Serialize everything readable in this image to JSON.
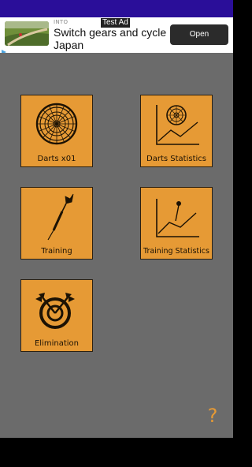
{
  "ad": {
    "brand": "INTO",
    "test_label": "Test Ad",
    "headline": "Switch gears and cycle Japan",
    "cta": "Open"
  },
  "menu": {
    "darts_x01": "Darts x01",
    "darts_statistics": "Darts Statistics",
    "training": "Training",
    "training_statistics": "Training Statistics",
    "elimination": "Elimination"
  },
  "help": {
    "label": "?"
  },
  "colors": {
    "status_bar": "#2a0e99",
    "background": "#6b6b6b",
    "tile": "#e69a35",
    "tile_border": "#2c2010",
    "help_accent": "#e69a35"
  },
  "icons": {
    "darts_x01": "dartboard-icon",
    "darts_statistics": "dartboard-chart-icon",
    "training": "dart-icon",
    "training_statistics": "dart-chart-icon",
    "elimination": "target-arrows-icon"
  }
}
